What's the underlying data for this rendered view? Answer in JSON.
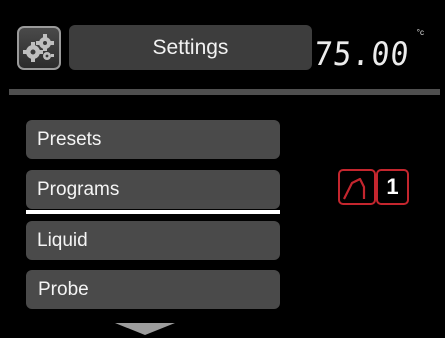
{
  "header": {
    "title": "Settings",
    "settings_icon": "gear-cluster-icon",
    "temperature": "75.00",
    "temperature_unit": "°c"
  },
  "menu": {
    "items": [
      {
        "label": "Presets",
        "selected": false
      },
      {
        "label": "Programs",
        "selected": true
      },
      {
        "label": "Liquid",
        "selected": false
      },
      {
        "label": "Probe",
        "selected": false
      }
    ],
    "scroll_icon": "triangle-down-icon"
  },
  "program_indicator": {
    "icon": "program-profile-icon",
    "number": "1",
    "accent_color": "#c4262e"
  },
  "colors": {
    "background": "#000000",
    "panel": "#4a4a4a",
    "accent": "#c4262e"
  }
}
